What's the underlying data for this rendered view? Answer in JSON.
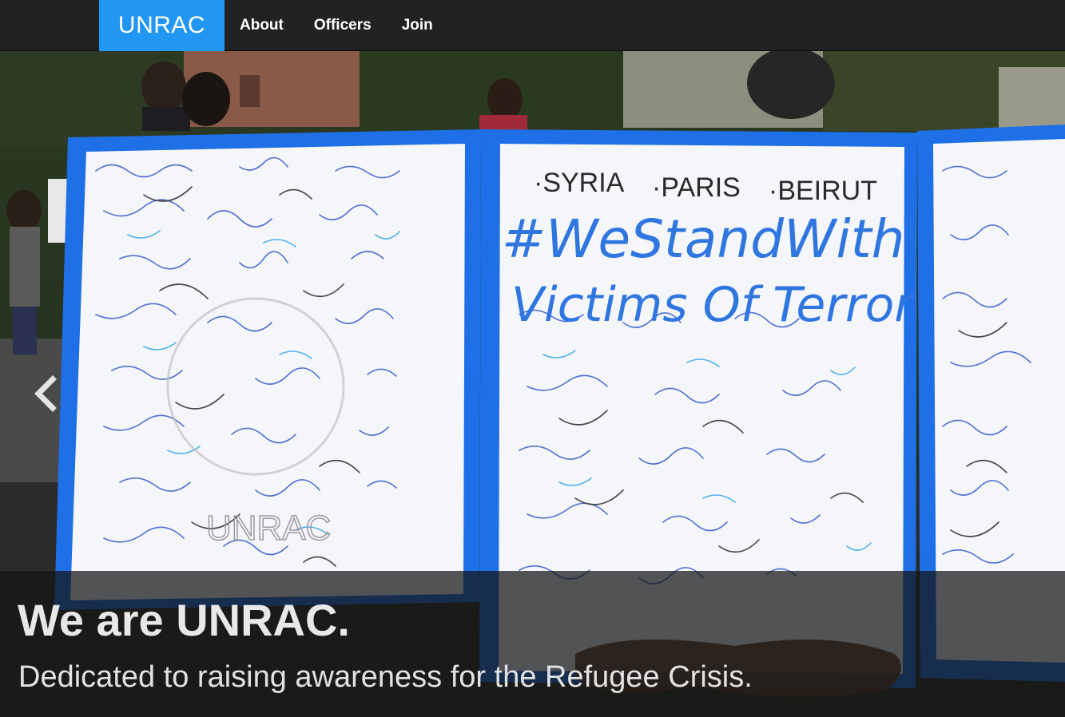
{
  "brand": "UNRAC",
  "nav": {
    "about": "About",
    "officers": "Officers",
    "join": "Join"
  },
  "hero": {
    "headline": "We are UNRAC.",
    "subline": "Dedicated to raising awareness for the Refugee Crisis.",
    "board_places": [
      "·SYRIA",
      "·PARIS",
      "·BEIRUT"
    ],
    "board_hashtag": "#WeStandWith",
    "board_line2": "Victims Of Terror",
    "board_logo": "UNRAC"
  },
  "carousel": {
    "prev_icon": "chevron-left-icon"
  },
  "colors": {
    "brand_blue": "#2196f3",
    "navbar": "#222222",
    "board_border": "#1e6fe0"
  }
}
